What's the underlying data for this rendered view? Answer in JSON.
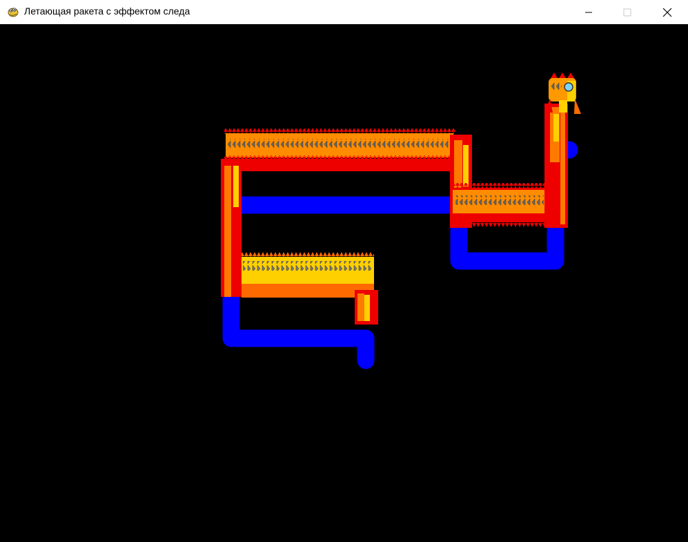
{
  "window": {
    "title": "Летающая ракета с эффектом следа",
    "app_icon": "pygame-snake-icon",
    "controls": {
      "minimize": "minimize-icon",
      "maximize": "maximize-icon",
      "close": "close-icon"
    }
  },
  "scene": {
    "background": "#000000",
    "colors": {
      "blue_path": "#0000FF",
      "trail_red": "#EE0000",
      "trail_orange": "#FF7A00",
      "trail_mid": "#FF9900",
      "trail_yellow": "#FFD000",
      "rocket_porthole": "#7FD3F5"
    }
  }
}
